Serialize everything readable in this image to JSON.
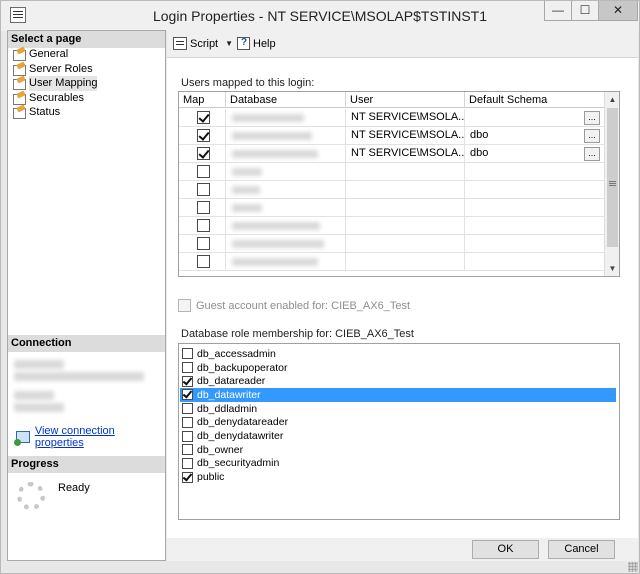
{
  "window": {
    "title": "Login Properties - NT SERVICE\\MSOLAP$TSTINST1",
    "minimize": "—",
    "maximize": "☐",
    "close": "✕"
  },
  "sidebar": {
    "select_page_heading": "Select a page",
    "pages": [
      {
        "label": "General",
        "selected": false
      },
      {
        "label": "Server Roles",
        "selected": false
      },
      {
        "label": "User Mapping",
        "selected": true
      },
      {
        "label": "Securables",
        "selected": false
      },
      {
        "label": "Status",
        "selected": false
      }
    ],
    "connection_heading": "Connection",
    "view_connection_link": "View connection properties",
    "progress_heading": "Progress",
    "progress_status": "Ready"
  },
  "toolbar": {
    "script_label": "Script",
    "help_label": "Help"
  },
  "users_mapped": {
    "label": "Users mapped to this login:",
    "columns": [
      "Map",
      "Database",
      "User",
      "Default Schema"
    ],
    "rows": [
      {
        "map": true,
        "user": "NT SERVICE\\MSOLA...",
        "schema": "",
        "has_ellipsis": true
      },
      {
        "map": true,
        "user": "NT SERVICE\\MSOLA...",
        "schema": "dbo",
        "has_ellipsis": true
      },
      {
        "map": true,
        "user": "NT SERVICE\\MSOLA...",
        "schema": "dbo",
        "has_ellipsis": true
      },
      {
        "map": false,
        "user": "",
        "schema": "",
        "has_ellipsis": false
      },
      {
        "map": false,
        "user": "",
        "schema": "",
        "has_ellipsis": false
      },
      {
        "map": false,
        "user": "",
        "schema": "",
        "has_ellipsis": false
      },
      {
        "map": false,
        "user": "",
        "schema": "",
        "has_ellipsis": false
      },
      {
        "map": false,
        "user": "",
        "schema": "",
        "has_ellipsis": false
      },
      {
        "map": false,
        "user": "",
        "schema": "",
        "has_ellipsis": false
      }
    ],
    "ellipsis": "...",
    "scroll_up": "▲",
    "scroll_down": "▼"
  },
  "guest": {
    "label": "Guest account enabled for: CIEB_AX6_Test",
    "checked": false
  },
  "role_membership": {
    "label": "Database role membership for: CIEB_AX6_Test",
    "roles": [
      {
        "name": "db_accessadmin",
        "checked": false,
        "selected": false
      },
      {
        "name": "db_backupoperator",
        "checked": false,
        "selected": false
      },
      {
        "name": "db_datareader",
        "checked": true,
        "selected": false
      },
      {
        "name": "db_datawriter",
        "checked": true,
        "selected": true
      },
      {
        "name": "db_ddladmin",
        "checked": false,
        "selected": false
      },
      {
        "name": "db_denydatareader",
        "checked": false,
        "selected": false
      },
      {
        "name": "db_denydatawriter",
        "checked": false,
        "selected": false
      },
      {
        "name": "db_owner",
        "checked": false,
        "selected": false
      },
      {
        "name": "db_securityadmin",
        "checked": false,
        "selected": false
      },
      {
        "name": "public",
        "checked": true,
        "selected": false
      }
    ]
  },
  "footer": {
    "ok_label": "OK",
    "cancel_label": "Cancel"
  }
}
